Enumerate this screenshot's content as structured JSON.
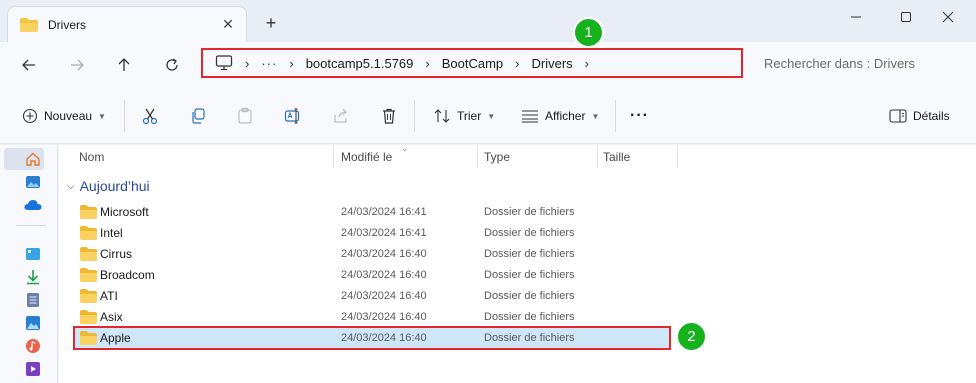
{
  "tab": {
    "title": "Drivers",
    "close": "✕",
    "new_tab": "+"
  },
  "window": {
    "minimize": "—",
    "maximize": "☐",
    "close": "✕"
  },
  "address": {
    "ellipsis": "···",
    "separator": "›",
    "crumbs": [
      "bootcamp5.1.5769",
      "BootCamp",
      "Drivers"
    ]
  },
  "search": {
    "placeholder": "Rechercher dans : Drivers"
  },
  "toolbar": {
    "new_label": "Nouveau",
    "sort_label": "Trier",
    "view_label": "Afficher",
    "more": "···",
    "details_label": "Détails"
  },
  "columns": {
    "name": "Nom",
    "date": "Modifié le",
    "type": "Type",
    "size": "Taille"
  },
  "group": {
    "label": "Aujourd’hui"
  },
  "files": [
    {
      "name": "Microsoft",
      "date": "24/03/2024 16:41",
      "type": "Dossier de fichiers"
    },
    {
      "name": "Intel",
      "date": "24/03/2024 16:41",
      "type": "Dossier de fichiers"
    },
    {
      "name": "Cirrus",
      "date": "24/03/2024 16:40",
      "type": "Dossier de fichiers"
    },
    {
      "name": "Broadcom",
      "date": "24/03/2024 16:40",
      "type": "Dossier de fichiers"
    },
    {
      "name": "ATI",
      "date": "24/03/2024 16:40",
      "type": "Dossier de fichiers"
    },
    {
      "name": "Asix",
      "date": "24/03/2024 16:40",
      "type": "Dossier de fichiers"
    },
    {
      "name": "Apple",
      "date": "24/03/2024 16:40",
      "type": "Dossier de fichiers"
    }
  ],
  "annotations": {
    "badge_1": "1",
    "badge_2": "2"
  },
  "colors": {
    "accent": "#2b4a9b",
    "highlight": "#e2262c",
    "badge": "#16b21e",
    "folder": "#f5c542",
    "selected": "#cfe5f8"
  }
}
